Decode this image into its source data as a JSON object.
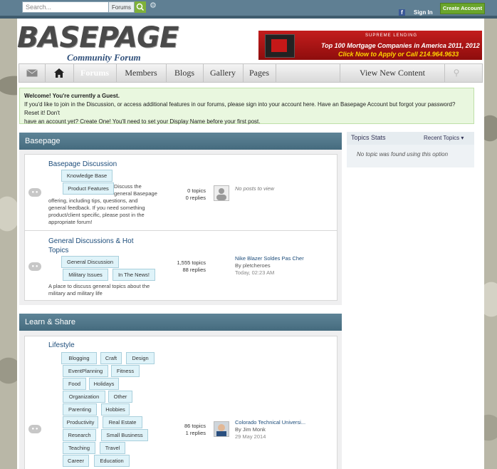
{
  "topbar": {
    "search_placeholder": "Search...",
    "search_scope": "Forums",
    "signin": "Sign In",
    "create_account": "Create Account",
    "facebook": "f"
  },
  "logo": {
    "main": "BASEPAGE",
    "sub": "Community Forum"
  },
  "ad": {
    "brand": "SUPREME LENDING",
    "line1": "Top 100 Mortgage Companies in America 2011, 2012",
    "line2": "Click Now to Apply or Call 214.964.9633"
  },
  "nav": {
    "items": [
      "Forums",
      "Members",
      "Blogs",
      "Gallery",
      "Pages"
    ],
    "right": "View New Content"
  },
  "welcome": {
    "title": "Welcome! You're currently a Guest.",
    "line1": "If you'd like to join in the Discussion, or access additional features in our forums, please sign into your account here. Have an Basepage Account but forgot your password? Reset it! Don't",
    "line2": "have an account yet? Create One! You'll need to set your Display Name before your first post."
  },
  "categories": [
    {
      "title": "Basepage",
      "forums": [
        {
          "title": "Basepage Discussion",
          "tags": [
            "Knowledge Base",
            "Product Features"
          ],
          "desc_lines": [
            "Discuss the",
            "general Basepage",
            "offering, including tips, questions, and",
            "general feedback. If you need something",
            "product/client specific, please post in the",
            "appropriate forum!"
          ],
          "topics": "0 topics",
          "replies": "0 replies",
          "last_post": "No posts to view"
        },
        {
          "title_lines": [
            "General Discussions & Hot",
            "Topics"
          ],
          "tags": [
            "General Discussion",
            "Military Issues",
            "In The News!"
          ],
          "desc_lines": [
            "A place to discuss general topics about the",
            "military and military life"
          ],
          "topics": "1,555 topics",
          "replies": "88 replies",
          "last_title": "Nike Blazer Soldes Pas Cher",
          "last_by": "By pletcheroes",
          "last_date": "Today, 02:23 AM"
        }
      ]
    },
    {
      "title": "Learn & Share",
      "forums": [
        {
          "title": "Lifestyle",
          "tags": [
            "Blogging",
            "Craft",
            "Design",
            "EventPlanning",
            "Fitness",
            "Food",
            "Holidays",
            "Organization",
            "Other",
            "Parenting",
            "Hobbies",
            "Productivity",
            "Real Estate",
            "Research",
            "Small Business",
            "Teaching",
            "Travel",
            "Career",
            "Education"
          ],
          "topics": "86 topics",
          "replies": "1 replies",
          "last_title": "Colorado Technical Universi...",
          "last_by": "By Jim Monk",
          "last_date": "29 May 2014"
        }
      ]
    }
  ],
  "sidebar": {
    "title": "Topics Stats",
    "select": "Recent Topics",
    "empty": "No topic was found using this option"
  },
  "colors": {
    "topbar": "#5f7f93",
    "accent_green": "#6aa52c",
    "category_header": "#4f7689"
  }
}
